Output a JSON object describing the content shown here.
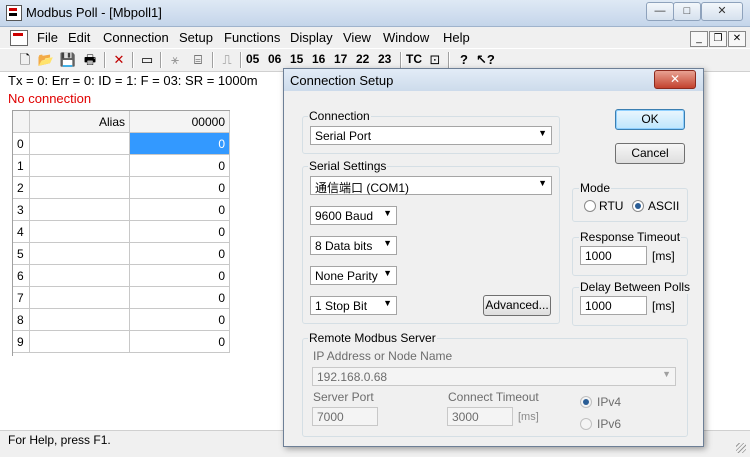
{
  "window": {
    "title": "Modbus Poll - [Mbpoll1]",
    "min_glyph": "—",
    "max_glyph": "□",
    "close_glyph": "✕"
  },
  "menu": [
    "File",
    "Edit",
    "Connection",
    "Setup",
    "Functions",
    "Display",
    "View",
    "Window",
    "Help"
  ],
  "mdi_controls": {
    "min": "_",
    "restore": "❐",
    "close": "✕"
  },
  "toolbar": {
    "function_codes": [
      "05",
      "06",
      "15",
      "16",
      "17",
      "22",
      "23"
    ],
    "tc_label": "TC"
  },
  "status_line": "Tx = 0: Err = 0: ID = 1: F = 03: SR = 1000m",
  "connection_error": "No connection",
  "grid": {
    "header_alias": "Alias",
    "header_address": "00000",
    "rows": [
      {
        "index": "0",
        "value": "0"
      },
      {
        "index": "1",
        "value": "0"
      },
      {
        "index": "2",
        "value": "0"
      },
      {
        "index": "3",
        "value": "0"
      },
      {
        "index": "4",
        "value": "0"
      },
      {
        "index": "5",
        "value": "0"
      },
      {
        "index": "6",
        "value": "0"
      },
      {
        "index": "7",
        "value": "0"
      },
      {
        "index": "8",
        "value": "0"
      },
      {
        "index": "9",
        "value": "0"
      }
    ]
  },
  "statusbar": {
    "help": "For Help, press F1."
  },
  "dialog": {
    "title": "Connection Setup",
    "close_glyph": "✕",
    "connection": {
      "label": "Connection",
      "value": "Serial Port"
    },
    "serial": {
      "label": "Serial Settings",
      "port": "通信端口 (COM1)",
      "baud": "9600 Baud",
      "data_bits": "8 Data bits",
      "parity": "None Parity",
      "stop_bits": "1 Stop Bit",
      "advanced": "Advanced..."
    },
    "buttons": {
      "ok": "OK",
      "cancel": "Cancel"
    },
    "mode": {
      "label": "Mode",
      "rtu": "RTU",
      "ascii": "ASCII",
      "selected": "ASCII"
    },
    "response_timeout": {
      "label": "Response Timeout",
      "value": "1000",
      "unit": "[ms]"
    },
    "delay_between_polls": {
      "label": "Delay Between Polls",
      "value": "1000",
      "unit": "[ms]"
    },
    "remote": {
      "label": "Remote Modbus Server",
      "ip_label": "IP Address or Node Name",
      "ip_value": "192.168.0.68",
      "port_label": "Server Port",
      "port_value": "7000",
      "timeout_label": "Connect Timeout",
      "timeout_value": "3000",
      "timeout_unit": "[ms]",
      "ipv4": "IPv4",
      "ipv6": "IPv6"
    }
  }
}
